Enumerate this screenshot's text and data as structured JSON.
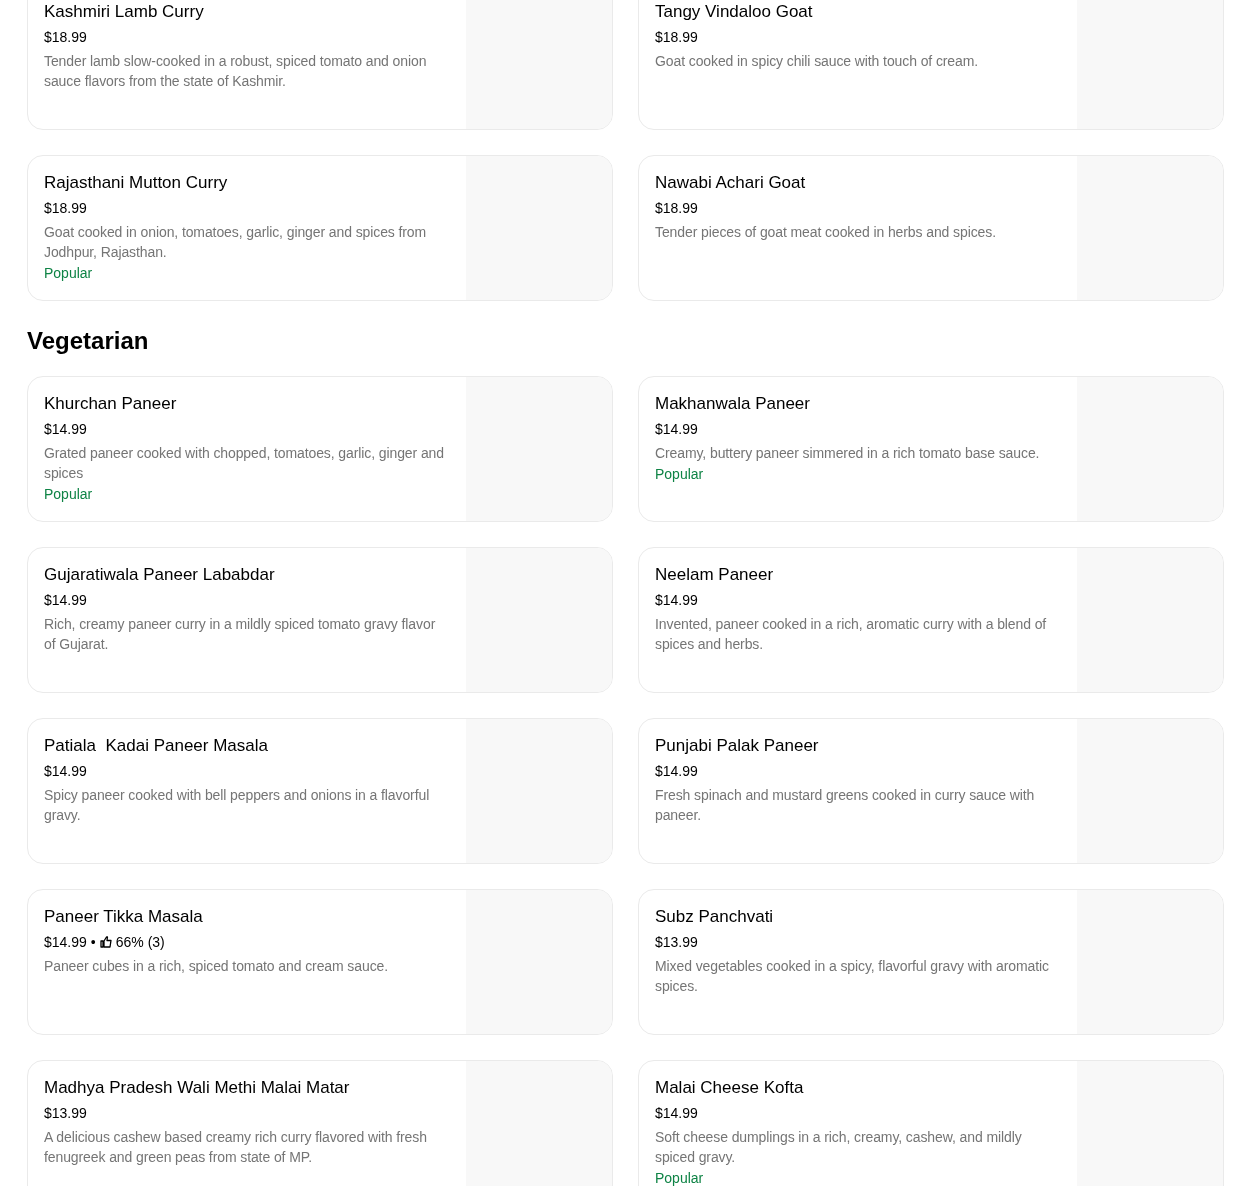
{
  "sections": [
    {
      "items": [
        {
          "name": "Kashmiri Lamb Curry",
          "price": "$18.99",
          "description": "Tender lamb slow-cooked in a robust, spiced tomato and onion sauce flavors from the state of Kashmir."
        },
        {
          "name": "Tangy Vindaloo Goat",
          "price": "$18.99",
          "description": "Goat cooked in spicy chili sauce with touch of cream."
        },
        {
          "name": "Rajasthani Mutton Curry",
          "price": "$18.99",
          "description": "Goat cooked in onion, tomatoes, garlic, ginger and spices from Jodhpur, Rajasthan.",
          "tag": "Popular"
        },
        {
          "name": "Nawabi Achari Goat",
          "price": "$18.99",
          "description": "Tender pieces of goat meat cooked in herbs and spices."
        }
      ]
    },
    {
      "title": "Vegetarian",
      "items": [
        {
          "name": "Khurchan Paneer",
          "price": "$14.99",
          "description": "Grated paneer cooked with chopped, tomatoes, garlic, ginger and spices",
          "tag": "Popular"
        },
        {
          "name": "Makhanwala Paneer",
          "price": "$14.99",
          "description": "Creamy, buttery paneer simmered in a rich tomato base sauce.",
          "tag": "Popular"
        },
        {
          "name": "Gujaratiwala Paneer Lababdar",
          "price": "$14.99",
          "description": "Rich, creamy paneer curry in a mildly spiced tomato gravy flavor of Gujarat."
        },
        {
          "name": "Neelam Paneer",
          "price": "$14.99",
          "description": "Invented, paneer cooked in a rich, aromatic curry with a blend of spices and herbs."
        },
        {
          "name": "Patiala  Kadai Paneer Masala",
          "price": "$14.99",
          "description": "Spicy paneer cooked with bell peppers and onions in a flavorful gravy."
        },
        {
          "name": "Punjabi Palak Paneer",
          "price": "$14.99",
          "description": "Fresh spinach and mustard greens cooked in curry sauce with paneer."
        },
        {
          "name": "Paneer Tikka Masala",
          "price": "$14.99",
          "separator": "•",
          "rating": "66% (3)",
          "description": "Paneer cubes in a rich, spiced tomato and cream sauce."
        },
        {
          "name": "Subz Panchvati",
          "price": "$13.99",
          "description": "Mixed vegetables cooked in a spicy, flavorful gravy with aromatic spices."
        },
        {
          "name": "Madhya Pradesh Wali Methi Malai Matar",
          "price": "$13.99",
          "description": "A delicious cashew based creamy rich curry flavored with fresh fenugreek and green peas from state of MP."
        },
        {
          "name": "Malai Cheese Kofta",
          "price": "$14.99",
          "description": "Soft cheese dumplings in a rich, creamy, cashew, and mildly spiced gravy.",
          "tag": "Popular"
        }
      ]
    }
  ]
}
